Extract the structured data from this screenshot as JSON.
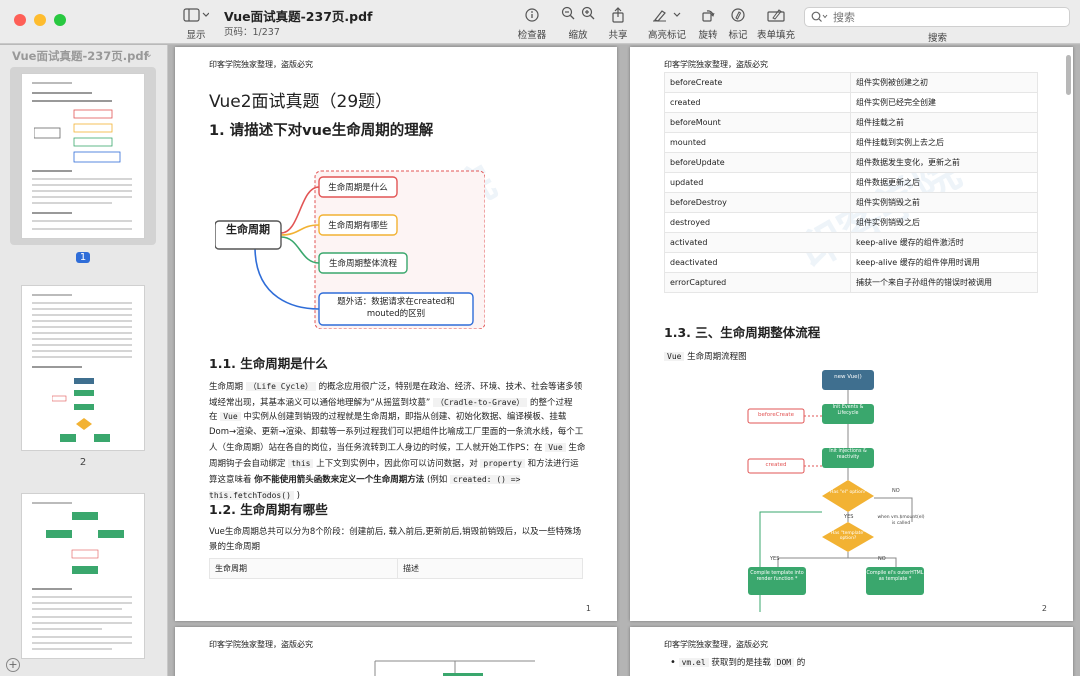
{
  "toolbar": {
    "display_label": "显示",
    "doc_title": "Vue面试真题-237页.pdf",
    "page_info": "页码：1/237",
    "inspector_label": "检查器",
    "zoom_label": "缩放",
    "share_label": "共享",
    "highlight_label": "高亮标记",
    "rotate_label": "旋转",
    "markup_label": "标记",
    "form_label": "表单填充",
    "search_label": "搜索",
    "search_placeholder": "搜索"
  },
  "sidebar": {
    "title": "Vue面试真题-237页.pdf",
    "thumbnails": [
      {
        "num": "1"
      },
      {
        "num": "2"
      },
      {
        "num": ""
      }
    ]
  },
  "page1": {
    "header": "印客学院独家整理，盗版必究",
    "doc_heading": "Vue2面试真题（29题）",
    "q1": "1. 请描述下对vue生命周期的理解",
    "mindmap": {
      "center": "生命周期",
      "b1": "生命周期是什么",
      "b2": "生命周期有哪些",
      "b3": "生命周期整体流程",
      "b4_line1": "题外话：数据请求在created和",
      "b4_line2": "mouted的区别"
    },
    "s11": "1.1. 生命周期是什么",
    "p_a1": "生命周期",
    "p_a_code": "（Life Cycle）",
    "p_a2": "的概念应用很广泛，特别是在政治、经济、环境、技术、社会等诸多领域经常出现，其基本涵义可以通俗地理解为“从摇篮到坟墓”",
    "p_a_code2": "（Cradle-to-Grave）",
    "p_a3": "的整个过程",
    "p_b1": "在",
    "p_b_code": "Vue",
    "p_b2": "中实例从创建到销毁的过程就是生命周期，即指从创建、初始化数据、编译模板、挂载Dom→渲染、更新→渲染、卸载等一系列过程我们可以把组件比喻成工厂里面的一条流水线，每个工人（生命周期）站在各自的岗位，当任务流转到工人身边的时候，工人就开始工作PS：在",
    "p_b_code2": "Vue",
    "p_b3": "生命周期钩子会自动绑定",
    "p_b_code3": "this",
    "p_b4": "上下文到实例中，因此你可以访问数据，对",
    "p_b_code4": "property",
    "p_b5": "和方法进行运算这意味着",
    "p_b_bold": "你不能使用箭头函数来定义一个生命周期方法",
    "p_b6": "(例如",
    "p_b_code5": "created: () => this.fetchTodos()",
    "p_b7": ")",
    "s12": "1.2. 生命周期有哪些",
    "p_c": "Vue生命周期总共可以分为8个阶段：创建前后, 载入前后,更新前后,销毁前销毁后，以及一些特殊场景的生命周期",
    "table_col1": "生命周期",
    "table_col2": "描述",
    "page_num": "1"
  },
  "page2": {
    "header": "印客学院独家整理，盗版必究",
    "rows": [
      {
        "name": "beforeCreate",
        "desc": "组件实例被创建之初"
      },
      {
        "name": "created",
        "desc": "组件实例已经完全创建"
      },
      {
        "name": "beforeMount",
        "desc": "组件挂载之前"
      },
      {
        "name": "mounted",
        "desc": "组件挂载到实例上去之后"
      },
      {
        "name": "beforeUpdate",
        "desc": "组件数据发生变化，更新之前"
      },
      {
        "name": "updated",
        "desc": "组件数据更新之后"
      },
      {
        "name": "beforeDestroy",
        "desc": "组件实例销毁之前"
      },
      {
        "name": "destroyed",
        "desc": "组件实例销毁之后"
      },
      {
        "name": "activated",
        "desc": "keep-alive 缓存的组件激活时"
      },
      {
        "name": "deactivated",
        "desc": "keep-alive 缓存的组件停用时调用"
      },
      {
        "name": "errorCaptured",
        "desc": "捕获一个来自子孙组件的错误时被调用"
      }
    ],
    "s13": "1.3. 三、生命周期整体流程",
    "p_d_code": "Vue",
    "p_d": "生命周期流程图",
    "flow": {
      "new_vue": "new Vue()",
      "init1": "Init Events & Lifecycle",
      "before_create": "beforeCreate",
      "init2": "Init injections & reactivity",
      "created": "created",
      "has_el": "Has \"el\" option?",
      "has_template": "Has \"template\" option?",
      "no1": "NO",
      "yes1": "YES",
      "yes2": "YES",
      "no2": "NO",
      "when": "when vm.$mount(el) is called",
      "compile1": "Compile template into render function *",
      "compile2": "Compile el's outerHTML as template *"
    },
    "page_num": "2"
  },
  "page3": {
    "header": "印客学院独家整理，盗版必究"
  },
  "page4": {
    "header": "印客学院独家整理，盗版必究",
    "bullet_code": "vm.el",
    "bullet_text1": "获取到的是挂载",
    "bullet_code2": "DOM",
    "bullet_text2": "的"
  },
  "watermark": "印客学院",
  "colors": {
    "accent": "#2f6dd8",
    "green": "#3aa76d",
    "red": "#e25555",
    "orange": "#f2b233"
  }
}
